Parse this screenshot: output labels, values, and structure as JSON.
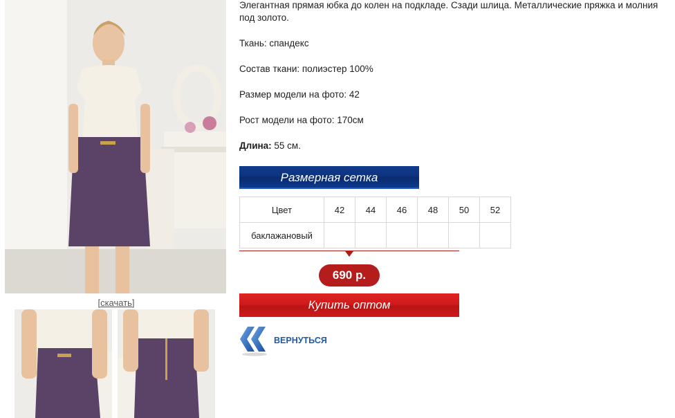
{
  "product": {
    "download_link": "[скачать]",
    "description": {
      "lead": "Элегантная прямая юбка до колен на подкладе. Сзади шлица. Металлические пряжка и молния под золото.",
      "fabric": "Ткань: спандекс",
      "composition": "Состав ткани: полиэстер 100%",
      "model_size": "Размер модели на фото: 42",
      "model_height": "Рост модели на фото: 170см",
      "length_label": "Длина:",
      "length_value": " 55 см."
    },
    "size_chart_button": "Размерная сетка",
    "size_table": {
      "header": [
        "Цвет",
        "42",
        "44",
        "46",
        "48",
        "50",
        "52"
      ],
      "rows": [
        [
          "баклажановый",
          "",
          "",
          "",
          "",
          "",
          ""
        ]
      ]
    },
    "price": "690 р.",
    "buy_button": "Купить оптом",
    "back_label": "ВЕРНУТЬСЯ"
  },
  "colors": {
    "blue_banner": "#0d3380",
    "red_button": "#d01a1a",
    "price_badge": "#b51c1c",
    "back_link": "#1e5aa8",
    "skirt": "#5a4366"
  },
  "icons": {
    "back": "double-chevron-left-icon"
  }
}
